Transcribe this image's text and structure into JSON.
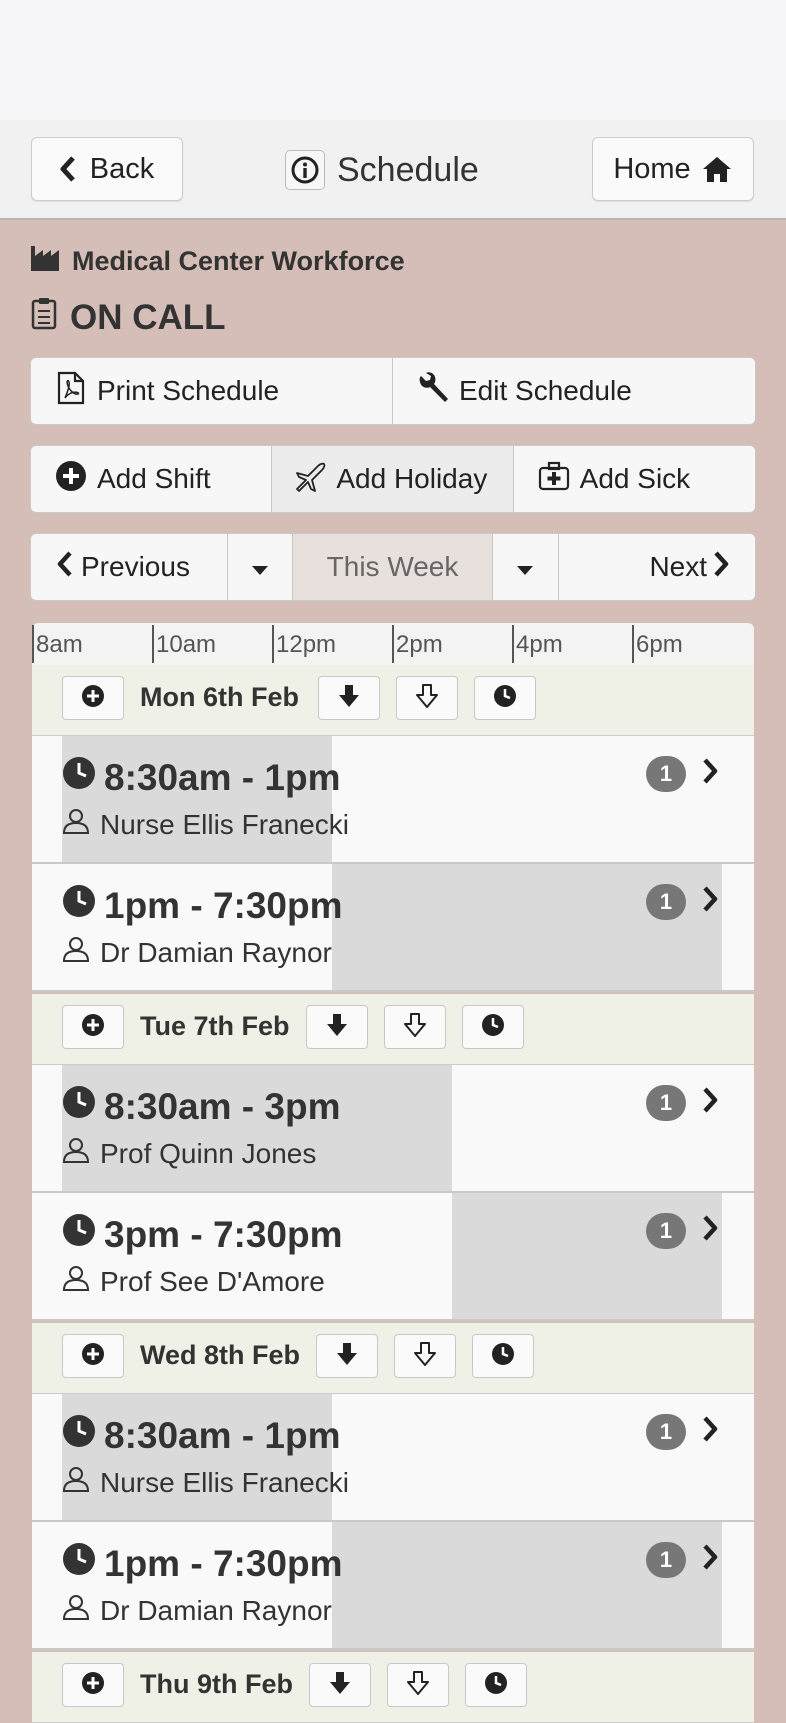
{
  "header": {
    "back_label": "Back",
    "title": "Schedule",
    "home_label": "Home"
  },
  "organization": "Medical Center Workforce",
  "roster_name": "ON CALL",
  "actions": {
    "print": "Print Schedule",
    "edit": "Edit Schedule",
    "add_shift": "Add Shift",
    "add_holiday": "Add Holiday",
    "add_sick": "Add Sick"
  },
  "nav": {
    "previous": "Previous",
    "current": "This Week",
    "next": "Next"
  },
  "timeline_ticks": [
    "8am",
    "10am",
    "12pm",
    "2pm",
    "4pm",
    "6pm"
  ],
  "days": [
    {
      "label": "Mon 6th Feb",
      "shifts": [
        {
          "time": "8:30am - 1pm",
          "person": "Nurse Ellis Franecki",
          "count": "1"
        },
        {
          "time": "1pm - 7:30pm",
          "person": "Dr Damian Raynor",
          "count": "1"
        }
      ]
    },
    {
      "label": "Tue 7th Feb",
      "shifts": [
        {
          "time": "8:30am - 3pm",
          "person": "Prof Quinn Jones",
          "count": "1"
        },
        {
          "time": "3pm - 7:30pm",
          "person": "Prof See D'Amore",
          "count": "1"
        }
      ]
    },
    {
      "label": "Wed 8th Feb",
      "shifts": [
        {
          "time": "8:30am - 1pm",
          "person": "Nurse Ellis Franecki",
          "count": "1"
        },
        {
          "time": "1pm - 7:30pm",
          "person": "Dr Damian Raynor",
          "count": "1"
        }
      ]
    },
    {
      "label": "Thu 9th Feb",
      "shifts": []
    }
  ],
  "colors": {
    "background": "#d5bdb8",
    "day_header": "#eff0e6",
    "shift_bar": "#dadada",
    "badge": "#777777"
  }
}
